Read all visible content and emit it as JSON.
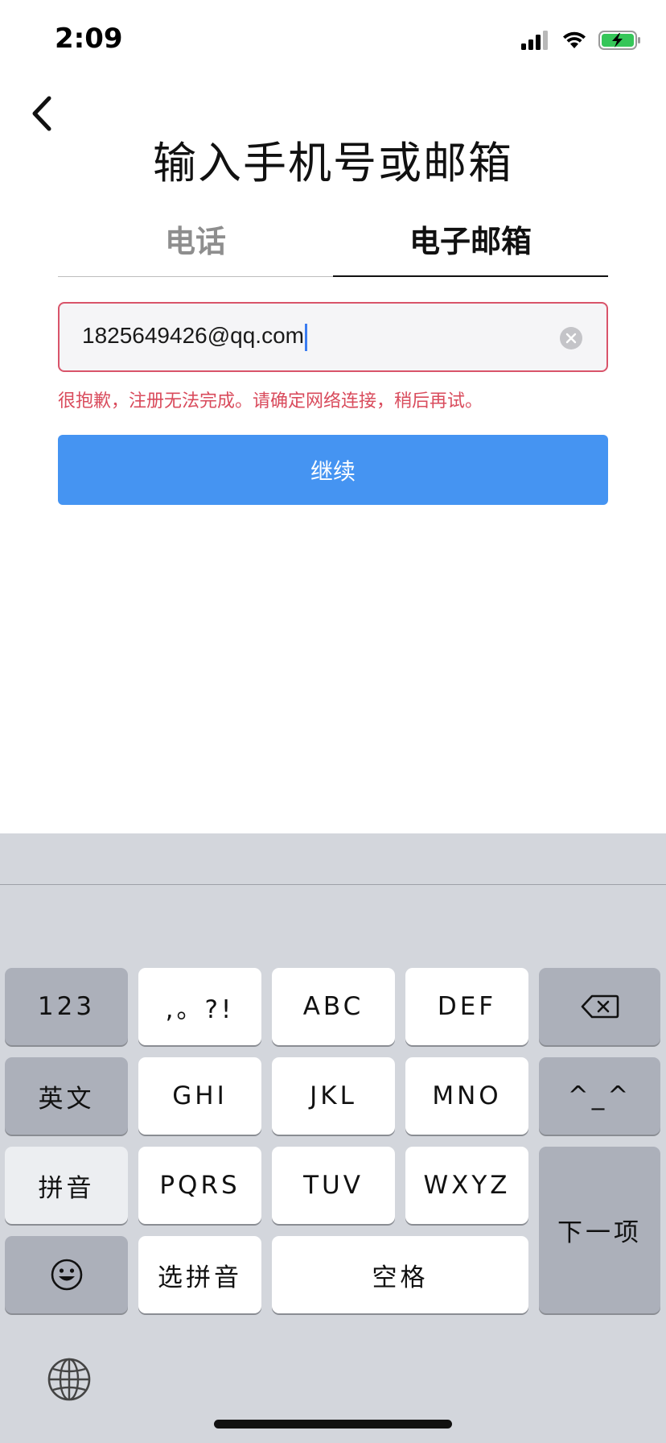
{
  "status": {
    "time": "2:09"
  },
  "nav": {
    "title": "输入手机号或邮箱"
  },
  "tabs": [
    {
      "label": "电话",
      "active": false
    },
    {
      "label": "电子邮箱",
      "active": true
    }
  ],
  "email_field": {
    "value": "1825649426@qq.com"
  },
  "error_message": "很抱歉，注册无法完成。请确定网络连接，稍后再试。",
  "continue_button": {
    "label": "继续"
  },
  "colors": {
    "accent": "#4594f2",
    "error": "#d94b5c",
    "keyboard_bg": "#d3d6dc"
  },
  "keyboard": {
    "numbers": "123",
    "punctuation": ",。?!",
    "abc": "ABC",
    "def": "DEF",
    "delete_icon": "delete-icon",
    "english": "英文",
    "ghi": "GHI",
    "jkl": "JKL",
    "mno": "MNO",
    "emoticon": "^_^",
    "pinyin": "拼音",
    "pqrs": "PQRS",
    "tuv": "TUV",
    "wxyz": "WXYZ",
    "next": "下一项",
    "emoji_icon": "emoji-icon",
    "select_pinyin": "选拼音",
    "space": "空格",
    "globe_icon": "globe-icon"
  }
}
